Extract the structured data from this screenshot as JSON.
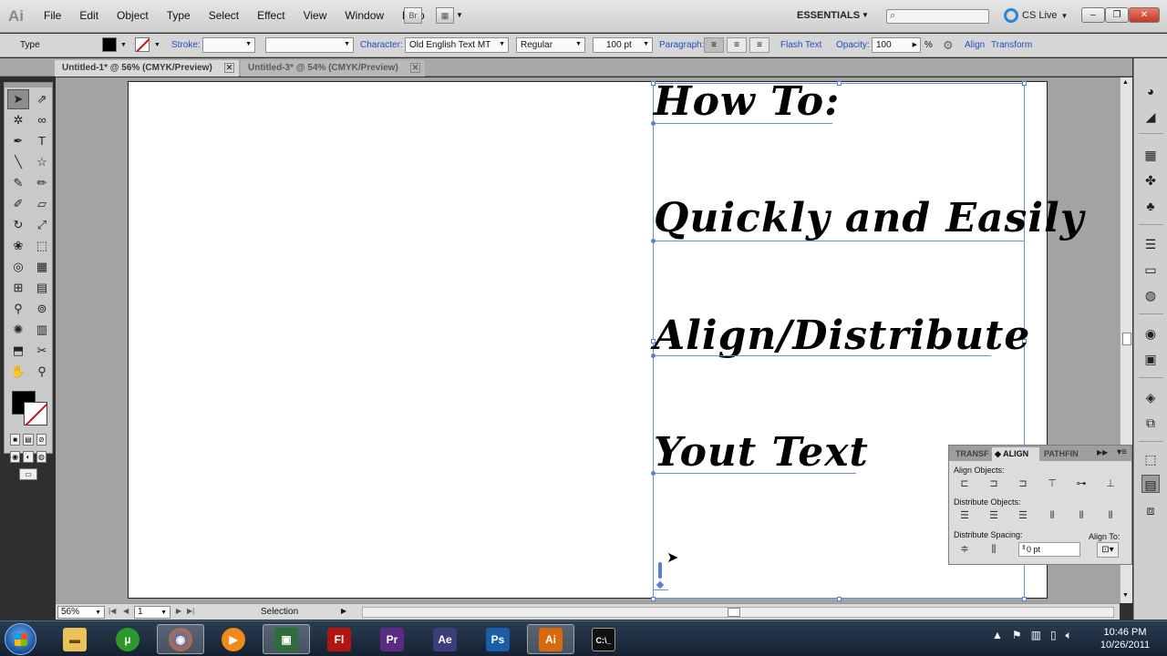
{
  "app": {
    "logo": "Ai"
  },
  "menu": [
    "File",
    "Edit",
    "Object",
    "Type",
    "Select",
    "Effect",
    "View",
    "Window",
    "Help"
  ],
  "menubar": {
    "bridge_label": "Br",
    "workspace": "ESSENTIALS",
    "cs_live": "CS Live",
    "search_placeholder": ""
  },
  "control": {
    "tool_name": "Type",
    "stroke_label": "Stroke:",
    "character_label": "Character:",
    "font_family": "Old English Text MT",
    "font_style": "Regular",
    "font_size": "100 pt",
    "paragraph_label": "Paragraph:",
    "flash_text_label": "Flash Text",
    "opacity_label": "Opacity:",
    "opacity_value": "100",
    "percent": "%",
    "align_label": "Align",
    "transform_label": "Transform"
  },
  "tabs": [
    {
      "label": "Untitled-1* @ 56% (CMYK/Preview)",
      "active": true
    },
    {
      "label": "Untitled-3* @ 54% (CMYK/Preview)",
      "active": false
    }
  ],
  "artwork": {
    "lines": [
      "How To:",
      "Quickly and Easily",
      "Align/Distribute",
      "Yout Text"
    ]
  },
  "status": {
    "zoom": "56%",
    "page": "1",
    "tool_status": "Selection"
  },
  "align_panel": {
    "tabs": [
      "TRANSF",
      "ALIGN",
      "PATHFIN"
    ],
    "align_objects": "Align Objects:",
    "distribute_objects": "Distribute Objects:",
    "distribute_spacing": "Distribute Spacing:",
    "align_to": "Align To:",
    "spacing_value": "0 pt"
  },
  "taskbar": {
    "apps": [
      "Explorer",
      "uTorrent",
      "Firefox",
      "Media Player",
      "Camtasia",
      "Fl",
      "Pr",
      "Ae",
      "Ps",
      "Ai",
      "Command Prompt"
    ],
    "time": "10:46 PM",
    "date": "10/26/2011"
  },
  "colors": {
    "selection": "#6b8fdc",
    "fill": "#000000",
    "link_blue": "#1f4fc4"
  }
}
